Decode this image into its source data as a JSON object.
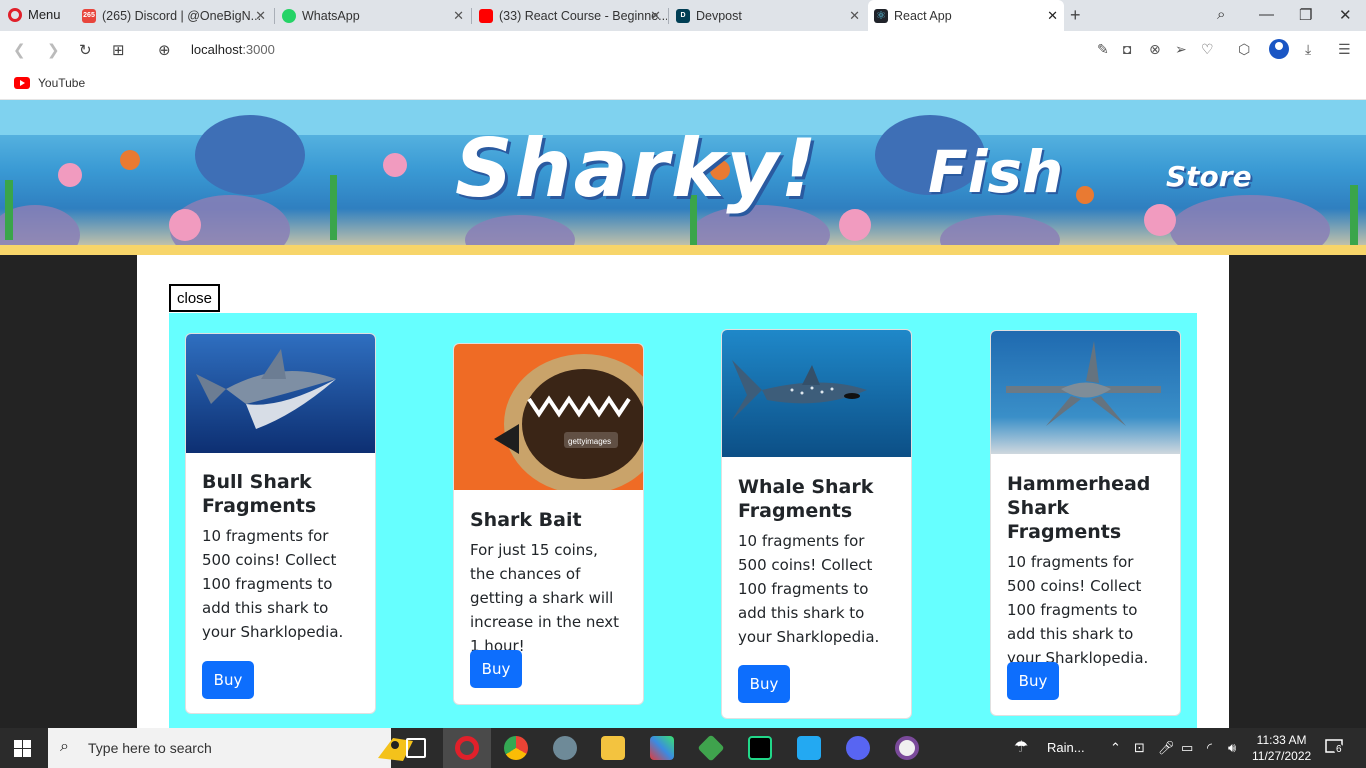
{
  "browser": {
    "menu_label": "Menu",
    "tabs": [
      {
        "title": "(265) Discord | @OneBigN...",
        "badge": "265"
      },
      {
        "title": "WhatsApp"
      },
      {
        "title": "(33) React Course - Beginne..."
      },
      {
        "title": "Devpost"
      },
      {
        "title": "React App"
      }
    ],
    "url_host": "localhost",
    "url_port": ":3000",
    "bookmark": "YouTube"
  },
  "banner": {
    "title_main": "Sharky!",
    "title_second": "Fish",
    "title_third": "Store"
  },
  "shop": {
    "close_label": "close",
    "cards": [
      {
        "title": "Bull Shark Fragments",
        "text": "10 fragments for 500 coins! Collect 100 fragments to add this shark to your Sharklopedia.",
        "button": "Buy"
      },
      {
        "title": "Shark Bait",
        "text": "For just 15 coins, the chances of getting a shark will increase in the next 1 hour!",
        "button": "Buy",
        "image_text": "gettyimages"
      },
      {
        "title": "Whale Shark Fragments",
        "text": "10 fragments for 500 coins! Collect 100 fragments to add this shark to your Sharklopedia.",
        "button": "Buy"
      },
      {
        "title": "Hammerhead Shark Fragments",
        "text": "10 fragments for 500 coins! Collect 100 fragments to add this shark to your Sharklopedia.",
        "button": "Buy"
      }
    ]
  },
  "taskbar": {
    "search_placeholder": "Type here to search",
    "weather": "Rain...",
    "time": "11:33 AM",
    "date": "11/27/2022",
    "notifications": "6"
  }
}
